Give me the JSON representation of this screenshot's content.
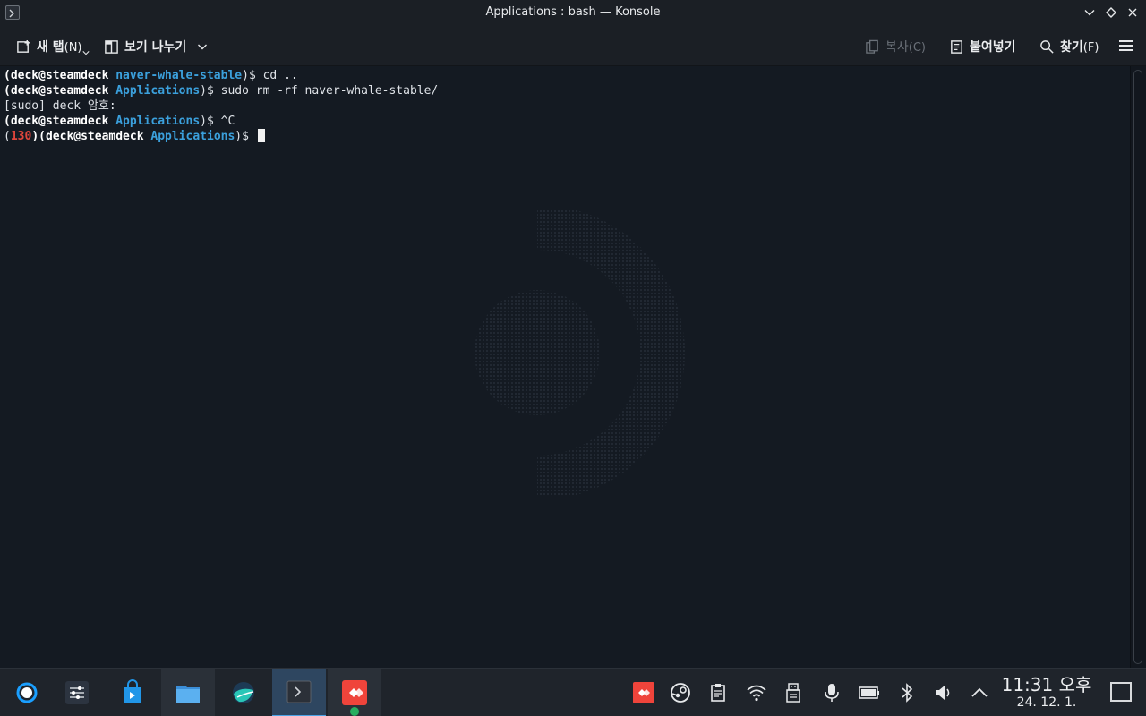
{
  "window": {
    "title": "Applications : bash — Konsole"
  },
  "toolbar": {
    "new_tab": "새 탭",
    "new_tab_accel": "(N)",
    "split_view": "보기 나누기",
    "copy": "복사",
    "copy_accel": "(C)",
    "paste": "붙여넣기",
    "find": "찾기",
    "find_accel": "(F)"
  },
  "terminal": {
    "lines": [
      {
        "user": "(deck@steamdeck",
        "dir": "naver-whale-stable",
        "end": ")$ cd .."
      },
      {
        "user": "(deck@steamdeck",
        "dir": "Applications",
        "end": ")$ sudo rm -rf naver-whale-stable/"
      },
      {
        "text": "[sudo] deck 암호:"
      },
      {
        "user": "(deck@steamdeck",
        "dir": "Applications",
        "end": ")$ ^C"
      },
      {
        "pre": "(",
        "code": "130",
        "post": ")(deck@steamdeck",
        "dir": "Applications",
        "end": ")$ "
      }
    ]
  },
  "taskbar": {
    "apps": [
      "steam-deck-launcher",
      "system-settings",
      "discover-store",
      "dolphin-files",
      "whale-browser",
      "konsole",
      "anydesk"
    ],
    "tray": [
      "anydesk-icon",
      "steam-icon",
      "clipboard-icon",
      "wifi-icon",
      "usb-storage-icon",
      "microphone-icon",
      "battery-icon",
      "bluetooth-icon",
      "volume-icon",
      "tray-expand-icon"
    ]
  },
  "clock": {
    "time": "11:31 오후",
    "date": "24. 12. 1."
  },
  "colors": {
    "accent": "#3ba0dc",
    "error": "#e0463c",
    "terminal_bg": "#141a22"
  }
}
